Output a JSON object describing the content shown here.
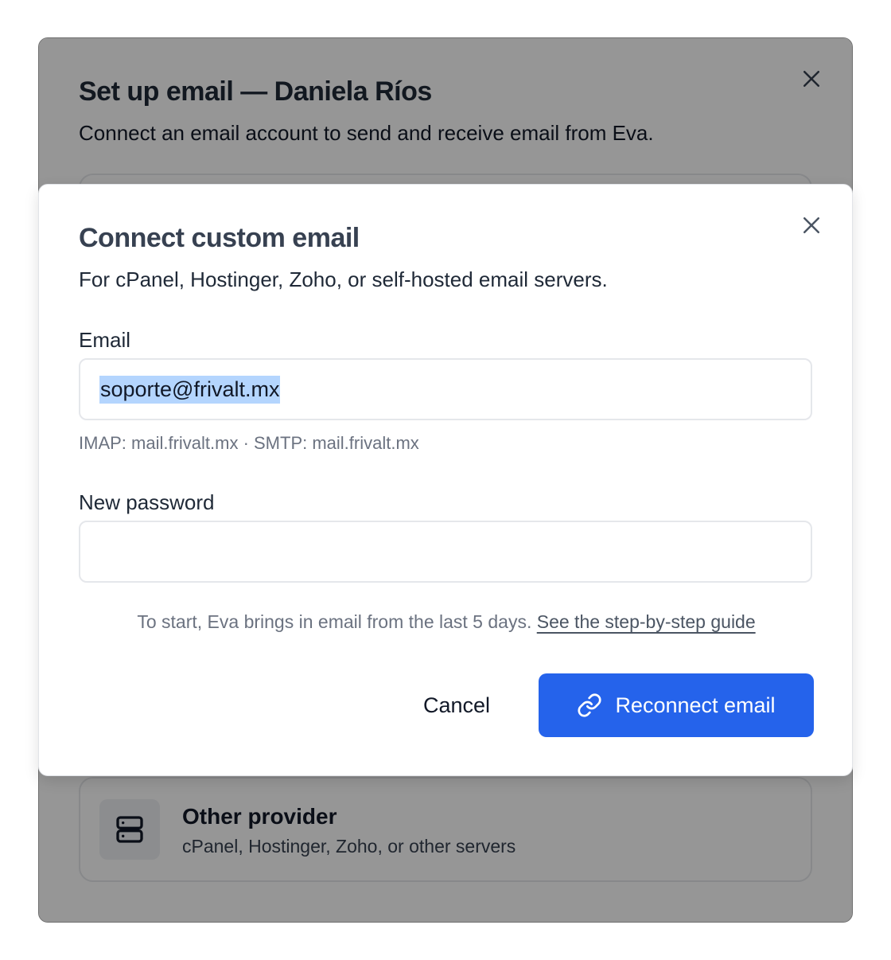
{
  "outer_dialog": {
    "title": "Set up email — Daniela Ríos",
    "subtitle": "Connect an email account to send and receive email from Eva.",
    "close_icon": "close-icon",
    "provider": {
      "name": "Other provider",
      "description": "cPanel, Hostinger, Zoho, or other servers",
      "icon": "server-icon"
    }
  },
  "modal": {
    "title": "Connect custom email",
    "subtitle": "For cPanel, Hostinger, Zoho, or self-hosted email servers.",
    "close_icon": "close-icon",
    "email": {
      "label": "Email",
      "value": "soporte@frivalt.mx",
      "helper": "IMAP: mail.frivalt.mx · SMTP: mail.frivalt.mx"
    },
    "password": {
      "label": "New password",
      "value": ""
    },
    "note": {
      "text": "To start, Eva brings in email from the last 5 days.",
      "link": "See the step-by-step guide"
    },
    "cancel_label": "Cancel",
    "primary_label": "Reconnect email",
    "primary_icon": "link-icon"
  },
  "colors": {
    "primary": "#2563eb",
    "selection": "#b4d5fe"
  }
}
